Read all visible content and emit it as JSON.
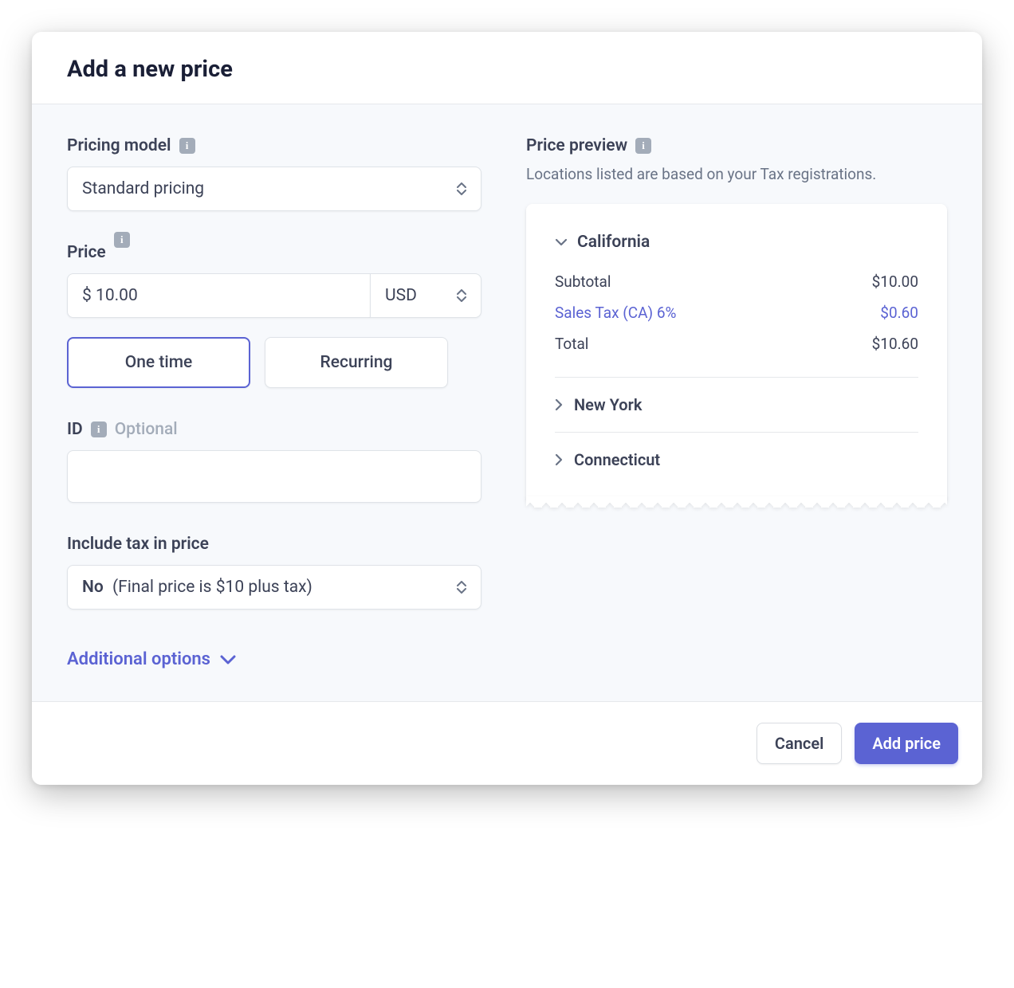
{
  "header": {
    "title": "Add a new price"
  },
  "pricing_model": {
    "label": "Pricing model",
    "value": "Standard pricing"
  },
  "price": {
    "label": "Price",
    "value": "$ 10.00",
    "currency": "USD",
    "one_time": "One time",
    "recurring": "Recurring"
  },
  "id": {
    "label": "ID",
    "optional": "Optional",
    "value": ""
  },
  "tax": {
    "label": "Include tax in price",
    "prefix": "No",
    "rest": "(Final price is $10 plus tax)"
  },
  "additional": {
    "label": "Additional options"
  },
  "preview": {
    "label": "Price preview",
    "sub": "Locations listed are based on your Tax registrations.",
    "locations": [
      {
        "name": "California",
        "expanded": true,
        "rows": {
          "subtotal_label": "Subtotal",
          "subtotal_value": "$10.00",
          "tax_label": "Sales Tax (CA) 6%",
          "tax_value": "$0.60",
          "total_label": "Total",
          "total_value": "$10.60"
        }
      },
      {
        "name": "New York",
        "expanded": false
      },
      {
        "name": "Connecticut",
        "expanded": false
      }
    ]
  },
  "footer": {
    "cancel": "Cancel",
    "add": "Add price"
  }
}
